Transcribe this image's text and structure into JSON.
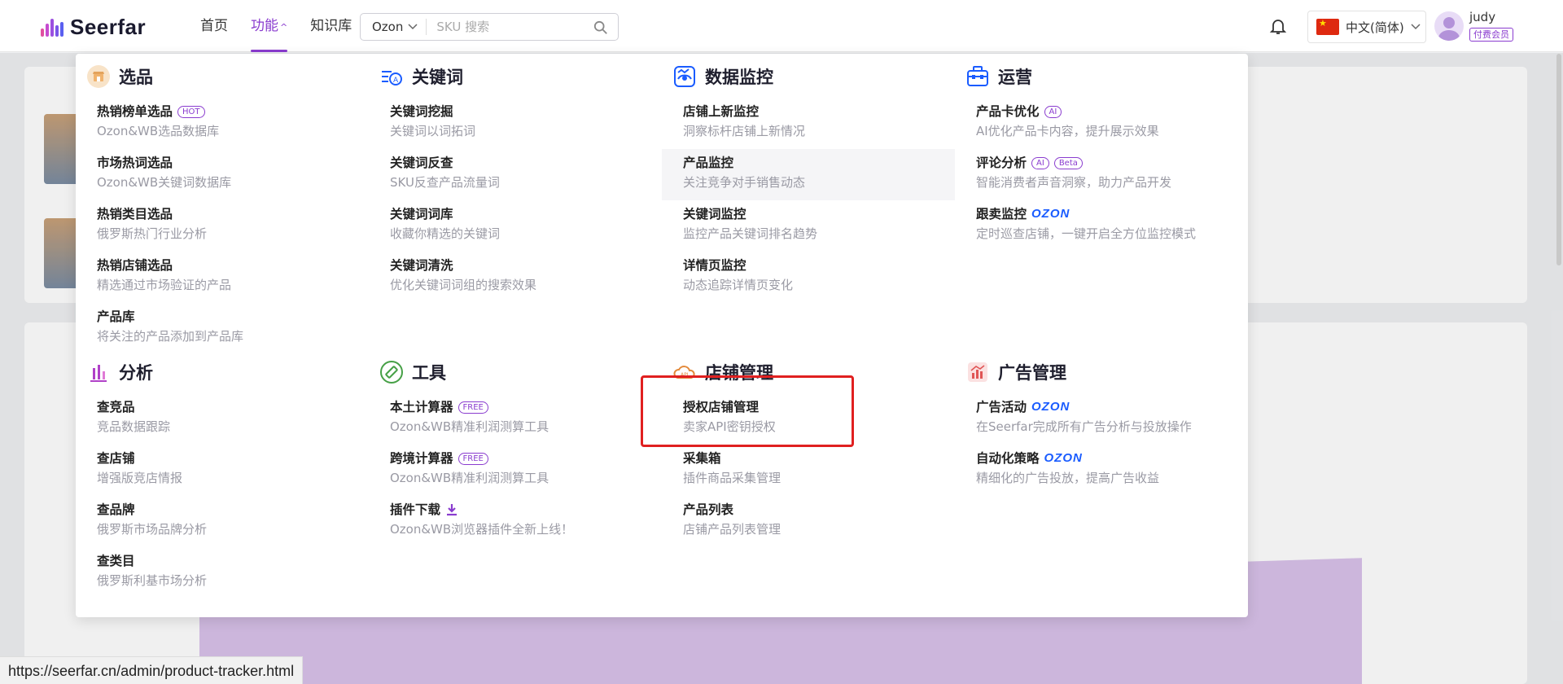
{
  "header": {
    "logo_text": "Seerfar",
    "nav": [
      {
        "label": "首页"
      },
      {
        "label": "功能",
        "chevron": "^"
      },
      {
        "label": "知识库"
      }
    ],
    "search": {
      "platform": "Ozon",
      "placeholder": "SKU 搜索"
    },
    "language": "中文(简体)",
    "user": {
      "name": "judy",
      "badge": "付费会员"
    }
  },
  "menu": {
    "sections": [
      {
        "title": "选品",
        "icon": "store-icon",
        "items": [
          {
            "title": "热销榜单选品",
            "tag": "HOT",
            "desc": "Ozon&WB选品数据库"
          },
          {
            "title": "市场热词选品",
            "desc": "Ozon&WB关键词数据库"
          },
          {
            "title": "热销类目选品",
            "desc": "俄罗斯热门行业分析"
          },
          {
            "title": "热销店铺选品",
            "desc": "精选通过市场验证的产品"
          },
          {
            "title": "产品库",
            "desc": "将关注的产品添加到产品库"
          }
        ]
      },
      {
        "title": "关键词",
        "icon": "keyword-icon",
        "items": [
          {
            "title": "关键词挖掘",
            "desc": "关键词以词拓词"
          },
          {
            "title": "关键词反查",
            "desc": "SKU反查产品流量词"
          },
          {
            "title": "关键词词库",
            "desc": "收藏你精选的关键词"
          },
          {
            "title": "关键词清洗",
            "desc": "优化关键词词组的搜索效果"
          }
        ]
      },
      {
        "title": "数据监控",
        "icon": "monitor-eye-icon",
        "items": [
          {
            "title": "店铺上新监控",
            "desc": "洞察标杆店铺上新情况"
          },
          {
            "title": "产品监控",
            "desc": "关注竞争对手销售动态"
          },
          {
            "title": "关键词监控",
            "desc": "监控产品关键词排名趋势"
          },
          {
            "title": "详情页监控",
            "desc": "动态追踪详情页变化"
          }
        ]
      },
      {
        "title": "运营",
        "icon": "toolbox-icon",
        "items": [
          {
            "title": "产品卡优化",
            "tag": "AI",
            "desc": "AI优化产品卡内容，提升展示效果"
          },
          {
            "title": "评论分析",
            "tag": "AI",
            "tag2": "Beta",
            "desc": "智能消费者声音洞察，助力产品开发"
          },
          {
            "title": "跟卖监控",
            "brand": "OZON",
            "desc": "定时巡查店铺，一键开启全方位监控模式"
          }
        ]
      },
      {
        "title": "分析",
        "icon": "bar-analysis-icon",
        "items": [
          {
            "title": "查竞品",
            "desc": "竞品数据跟踪"
          },
          {
            "title": "查店铺",
            "desc": "增强版竞店情报"
          },
          {
            "title": "查品牌",
            "desc": "俄罗斯市场品牌分析"
          },
          {
            "title": "查类目",
            "desc": "俄罗斯利基市场分析"
          }
        ]
      },
      {
        "title": "工具",
        "icon": "ruler-tool-icon",
        "items": [
          {
            "title": "本土计算器",
            "tag": "FREE",
            "desc": "Ozon&WB精准利润测算工具"
          },
          {
            "title": "跨境计算器",
            "tag": "FREE",
            "desc": "Ozon&WB精准利润测算工具"
          },
          {
            "title": "插件下载",
            "download": true,
            "desc": "Ozon&WB浏览器插件全新上线！"
          }
        ]
      },
      {
        "title": "店铺管理",
        "icon": "cloud-store-icon",
        "items": [
          {
            "title": "授权店铺管理",
            "desc": "卖家API密钥授权"
          },
          {
            "title": "采集箱",
            "desc": "插件商品采集管理"
          },
          {
            "title": "产品列表",
            "desc": "店铺产品列表管理"
          }
        ]
      },
      {
        "title": "广告管理",
        "icon": "ad-chart-icon",
        "items": [
          {
            "title": "广告活动",
            "brand": "OZON",
            "desc": "在Seerfar完成所有广告分析与投放操作"
          },
          {
            "title": "自动化策略",
            "brand": "OZON",
            "desc": "精细化的广告投放，提高广告收益"
          }
        ]
      }
    ]
  },
  "status_url": "https://seerfar.cn/admin/product-tracker.html",
  "colors": {
    "accent": "#8a3ccf",
    "ozon": "#1a5cff",
    "highlight": "#e02020"
  }
}
